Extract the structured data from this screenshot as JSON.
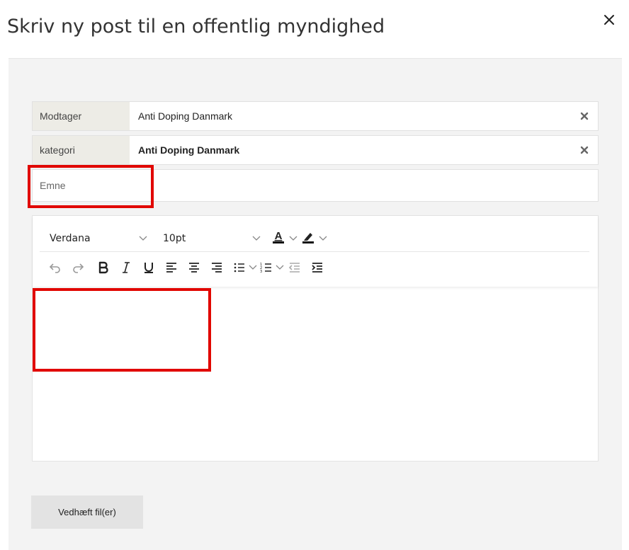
{
  "dialog": {
    "title": "Skriv ny post til en offentlig myndighed"
  },
  "form": {
    "recipient": {
      "label": "Modtager",
      "value": "Anti Doping Danmark"
    },
    "category": {
      "label": "kategori",
      "value": "Anti Doping Danmark"
    },
    "subject": {
      "placeholder": "Emne",
      "value": ""
    }
  },
  "editor": {
    "font_family": "Verdana",
    "font_size": "10pt",
    "text_color_letter": "A",
    "icons": [
      "undo-icon",
      "redo-icon",
      "bold-icon",
      "italic-icon",
      "underline-icon",
      "align-left-icon",
      "align-center-icon",
      "align-right-icon",
      "bullet-list-icon",
      "numbered-list-icon",
      "outdent-icon",
      "indent-icon"
    ],
    "text_color": "#000000",
    "highlight_color": "#000000"
  },
  "actions": {
    "attach_label": "Vedhæft fil(er)"
  },
  "annotations": {
    "highlight_color": "#e10600"
  }
}
